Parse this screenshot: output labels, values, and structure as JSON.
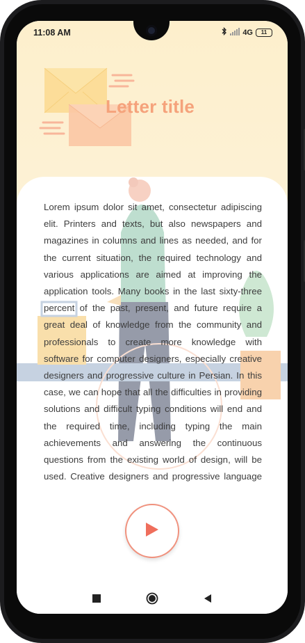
{
  "status_bar": {
    "time": "11:08 AM",
    "network": "4G",
    "battery": "11"
  },
  "header": {
    "title": "Letter title",
    "colors": {
      "background": "#fdefcc",
      "title": "#f5a27b",
      "envelope_front": "#fbc9a6",
      "envelope_back": "#fbe3a6"
    }
  },
  "content": {
    "body": "Lorem ipsum dolor sit amet, consectetur adipiscing elit. Printers and texts, but also newspapers and magazines in columns and lines as needed, and for the current situation, the required technology and various applications are aimed at improving the application tools. Many books in the last sixty-three percent of the past, present, and future require a great deal of knowledge from the community and professionals to create more knowledge with software for computer designers, especially creative designers and progressive culture in Persian. In this case, we can hope that all the difficulties in providing solutions and difficult typing conditions will end and the required time, including typing the main achievements and answering the continuous questions from the existing world of design, will be used. Creative designers and progressive language culture He created Persian."
  },
  "player": {
    "button_icon": "play-icon",
    "accent": "#f0917d"
  },
  "navbar": {
    "icons": [
      "recent-apps-icon",
      "home-icon",
      "back-icon"
    ]
  }
}
